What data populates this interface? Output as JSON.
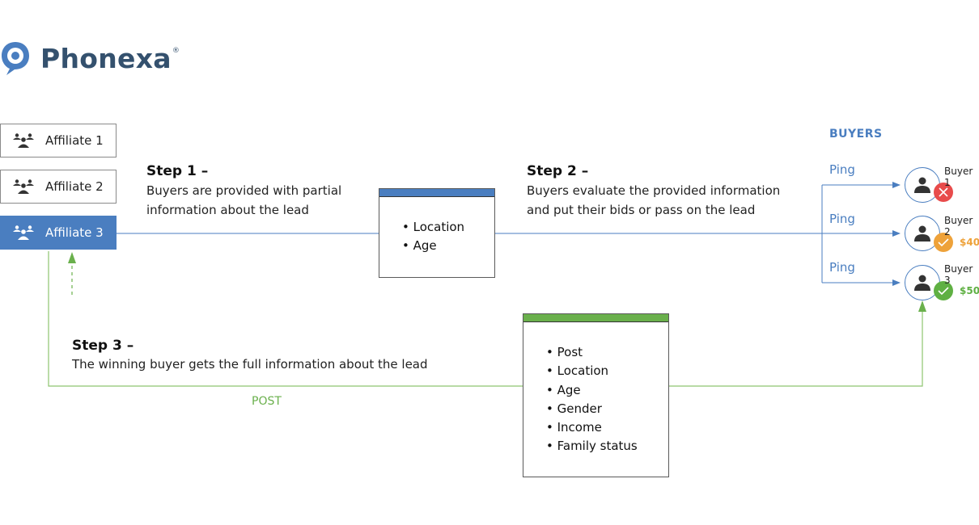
{
  "brand": {
    "name": "Phonexa",
    "registered_mark": "®",
    "color": "#34516e",
    "icon": "chat-bubble-pin-icon"
  },
  "colors": {
    "ping_blue": "#4a7ec0",
    "post_green": "#6ab04c",
    "reject_red": "#e84b4b",
    "bid_orange": "#eea23a",
    "win_green": "#5fb043"
  },
  "affiliates": [
    {
      "label": "Affiliate 1",
      "active": false,
      "icon": "group-icon"
    },
    {
      "label": "Affiliate 2",
      "active": false,
      "icon": "group-icon"
    },
    {
      "label": "Affiliate 3",
      "active": true,
      "icon": "group-icon"
    }
  ],
  "steps": {
    "step1": {
      "title": "Step 1 –",
      "lines": [
        "Buyers are provided with partial",
        "information about the lead"
      ]
    },
    "step2": {
      "title": "Step 2 –",
      "lines": [
        "Buyers evaluate the provided information",
        "and put their bids or pass on the lead"
      ]
    },
    "step3": {
      "title": "Step 3 –",
      "lines": [
        "The winning buyer gets the full information about the lead"
      ]
    }
  },
  "ping_box": {
    "items": [
      "Location",
      "Age"
    ]
  },
  "post_box": {
    "items": [
      "Post",
      "Location",
      "Age",
      "Gender",
      "Income",
      "Family status"
    ]
  },
  "buyers_section": {
    "label": "BUYERS",
    "ping_label": "Ping",
    "buyers": [
      {
        "name": "Buyer 1",
        "status": "rejected",
        "status_icon": "x-icon",
        "bid": ""
      },
      {
        "name": "Buyer 2",
        "status": "bid",
        "status_icon": "check-icon",
        "bid": "$40"
      },
      {
        "name": "Buyer 3",
        "status": "winner",
        "status_icon": "check-icon",
        "bid": "$50"
      }
    ]
  },
  "post_label": "POST"
}
